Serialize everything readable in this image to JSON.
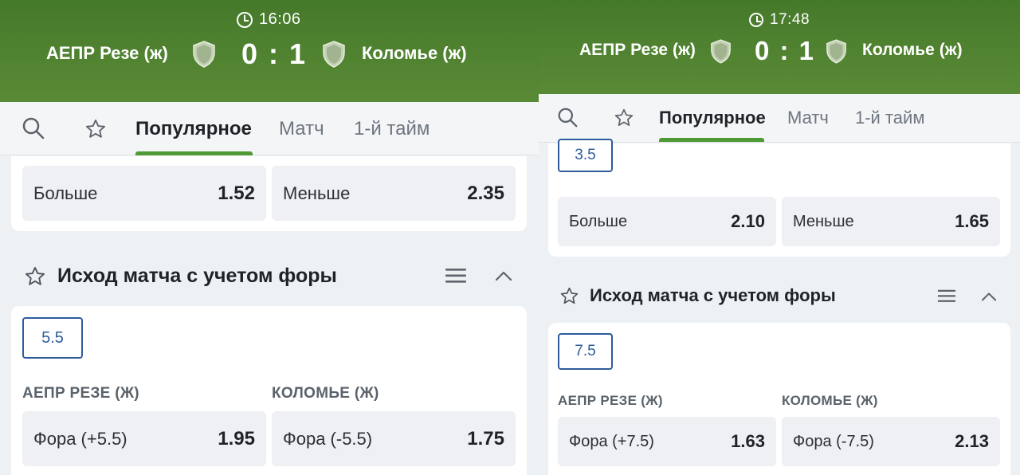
{
  "left": {
    "time": "16:06",
    "home_team": "АЕПР Резе (ж)",
    "away_team": "Коломье (ж)",
    "score": "0 : 1",
    "tabs": [
      "Популярное",
      "Матч",
      "1-й тайм"
    ],
    "total_row": {
      "over_label": "Больше",
      "over_odd": "1.52",
      "under_label": "Меньше",
      "under_odd": "2.35"
    },
    "handicap": {
      "title": "Исход матча с учетом форы",
      "line": "5.5",
      "home_col": "АЕПР РЕЗЕ (Ж)",
      "away_col": "КОЛОМЬЕ (Ж)",
      "home_label": "Фора (+5.5)",
      "home_odd": "1.95",
      "away_label": "Фора (-5.5)",
      "away_odd": "1.75"
    }
  },
  "right": {
    "time": "17:48",
    "home_team": "АЕПР Резе (ж)",
    "away_team": "Коломье (ж)",
    "score": "0 : 1",
    "tabs": [
      "Популярное",
      "Матч",
      "1-й тайм"
    ],
    "total_line": "3.5",
    "total_row": {
      "over_label": "Больше",
      "over_odd": "2.10",
      "under_label": "Меньше",
      "under_odd": "1.65"
    },
    "handicap": {
      "title": "Исход матча с учетом форы",
      "line": "7.5",
      "home_col": "АЕПР РЕЗЕ (Ж)",
      "away_col": "КОЛОМЬЕ (Ж)",
      "home_label": "Фора (+7.5)",
      "home_odd": "1.63",
      "away_label": "Фора (-7.5)",
      "away_odd": "2.13"
    }
  },
  "icons": {
    "clock": "clock-icon",
    "shield": "team-shield-icon",
    "search": "search-icon",
    "star": "star-icon",
    "menu": "menu-lines-icon",
    "collapse": "chevron-up-icon"
  },
  "colors": {
    "header_green": "#4e7f2e",
    "tab_active_underline": "#4e9a34",
    "chip_blue": "#2e5c9b"
  }
}
